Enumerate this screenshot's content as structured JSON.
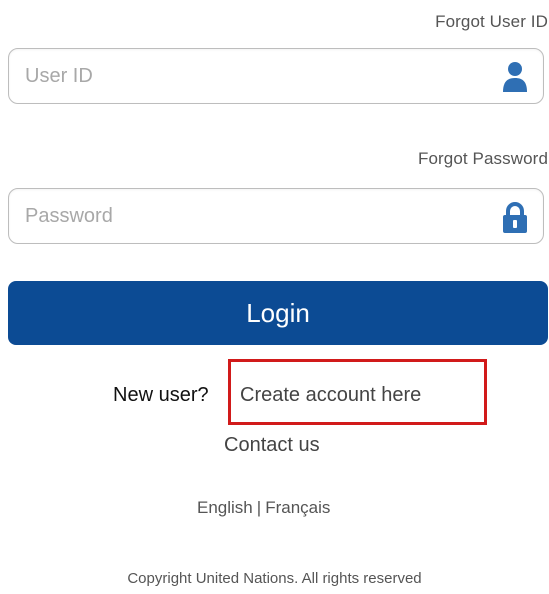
{
  "links": {
    "forgot_user_id": "Forgot User ID",
    "forgot_password": "Forgot Password",
    "create_account": "Create account here",
    "contact_us": "Contact us"
  },
  "fields": {
    "user_id": {
      "placeholder": "User ID",
      "value": "",
      "icon": "user-icon"
    },
    "password": {
      "placeholder": "Password",
      "value": "",
      "icon": "lock-icon"
    }
  },
  "login_button": {
    "label": "Login",
    "color": "#0c4b94"
  },
  "new_user_label": "New user?",
  "highlight": {
    "color": "#d11a1a"
  },
  "languages": {
    "english": "English",
    "separator": "|",
    "french": "Français"
  },
  "footer": {
    "copyright": "Copyright United Nations. All rights reserved"
  }
}
